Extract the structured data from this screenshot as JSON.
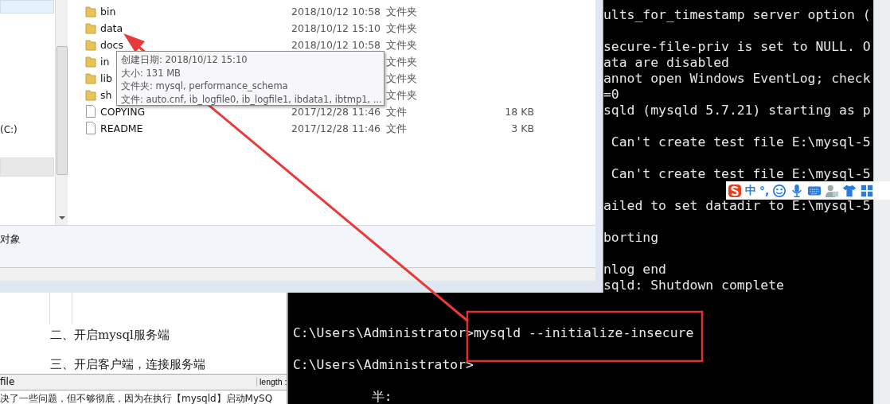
{
  "explorer": {
    "files": [
      {
        "kind": "folder",
        "name": "bin",
        "date": "2018/10/12 10:58",
        "type": "文件夹"
      },
      {
        "kind": "folder",
        "name": "data",
        "date": "2018/10/12 15:10",
        "type": "文件夹"
      },
      {
        "kind": "folder",
        "name": "docs",
        "date": "2018/10/12 10:58",
        "type": "文件夹"
      },
      {
        "kind": "folder",
        "name": "in",
        "type": "文件夹"
      },
      {
        "kind": "folder",
        "name": "lib",
        "type": "文件夹"
      },
      {
        "kind": "folder",
        "name": "sh",
        "type": "文件夹"
      },
      {
        "kind": "file",
        "name": "COPYING",
        "date": "2017/12/28 11:46",
        "type": "文件",
        "size": "18 KB"
      },
      {
        "kind": "file",
        "name": "README",
        "date": "2017/12/28 11:46",
        "type": "文件",
        "size": "3 KB"
      }
    ],
    "nav_items": [
      "(C:)"
    ],
    "status": "对象",
    "tooltip": [
      "创建日期: 2018/10/12 15:10",
      "大小: 131 MB",
      "文件夹: mysql, performance_schema",
      "文件: auto.cnf, ib_logfile0, ib_logfile1, ibdata1, ibtmp1, ..."
    ]
  },
  "console": {
    "lines": [
      {
        "kind": "blank"
      },
      {
        "kind": "clipped",
        "text": "ults_for_timestamp server option ("
      },
      {
        "kind": "blank"
      },
      {
        "kind": "clipped",
        "text": "secure-file-priv is set to NULL. O"
      },
      {
        "kind": "clipped",
        "text": "ata are disabled"
      },
      {
        "kind": "clipped",
        "text": "annot open Windows EventLog; check"
      },
      {
        "kind": "clipped",
        "text": "=0"
      },
      {
        "kind": "clipped",
        "text": "sqld (mysqld 5.7.21) starting as p"
      },
      {
        "kind": "blank"
      },
      {
        "kind": "clipped",
        "text": " Can't create test file E:\\mysql-5"
      },
      {
        "kind": "blank"
      },
      {
        "kind": "clipped",
        "text": " Can't create test file E:\\mysql-5"
      },
      {
        "kind": "blank"
      },
      {
        "kind": "clipped",
        "text": "ailed to set datadir to E:\\mysql-5"
      },
      {
        "kind": "blank"
      },
      {
        "kind": "clipped",
        "text": "borting"
      },
      {
        "kind": "blank"
      },
      {
        "kind": "clipped",
        "text": "nlog end"
      },
      {
        "kind": "clipped",
        "text": "sqld: Shutdown complete"
      },
      {
        "kind": "blank"
      },
      {
        "kind": "blank"
      },
      {
        "kind": "full",
        "text": "C:\\Users\\Administrator>mysqld --initialize-insecure"
      },
      {
        "kind": "blank"
      },
      {
        "kind": "full",
        "text": "C:\\Users\\Administrator>"
      },
      {
        "kind": "blank"
      },
      {
        "kind": "full",
        "text": "          半:"
      }
    ]
  },
  "ime_bar": {
    "mode": "中",
    "punctuation": "°,"
  },
  "editor": {
    "lines": [
      "二、开启mysql服务端",
      "三、开启客户端，连接服务端"
    ],
    "status": [
      "file",
      "length :"
    ]
  },
  "browser_text": "决了一些问题，但不够彻底，因为在执行【mysqld】启动MySQ"
}
